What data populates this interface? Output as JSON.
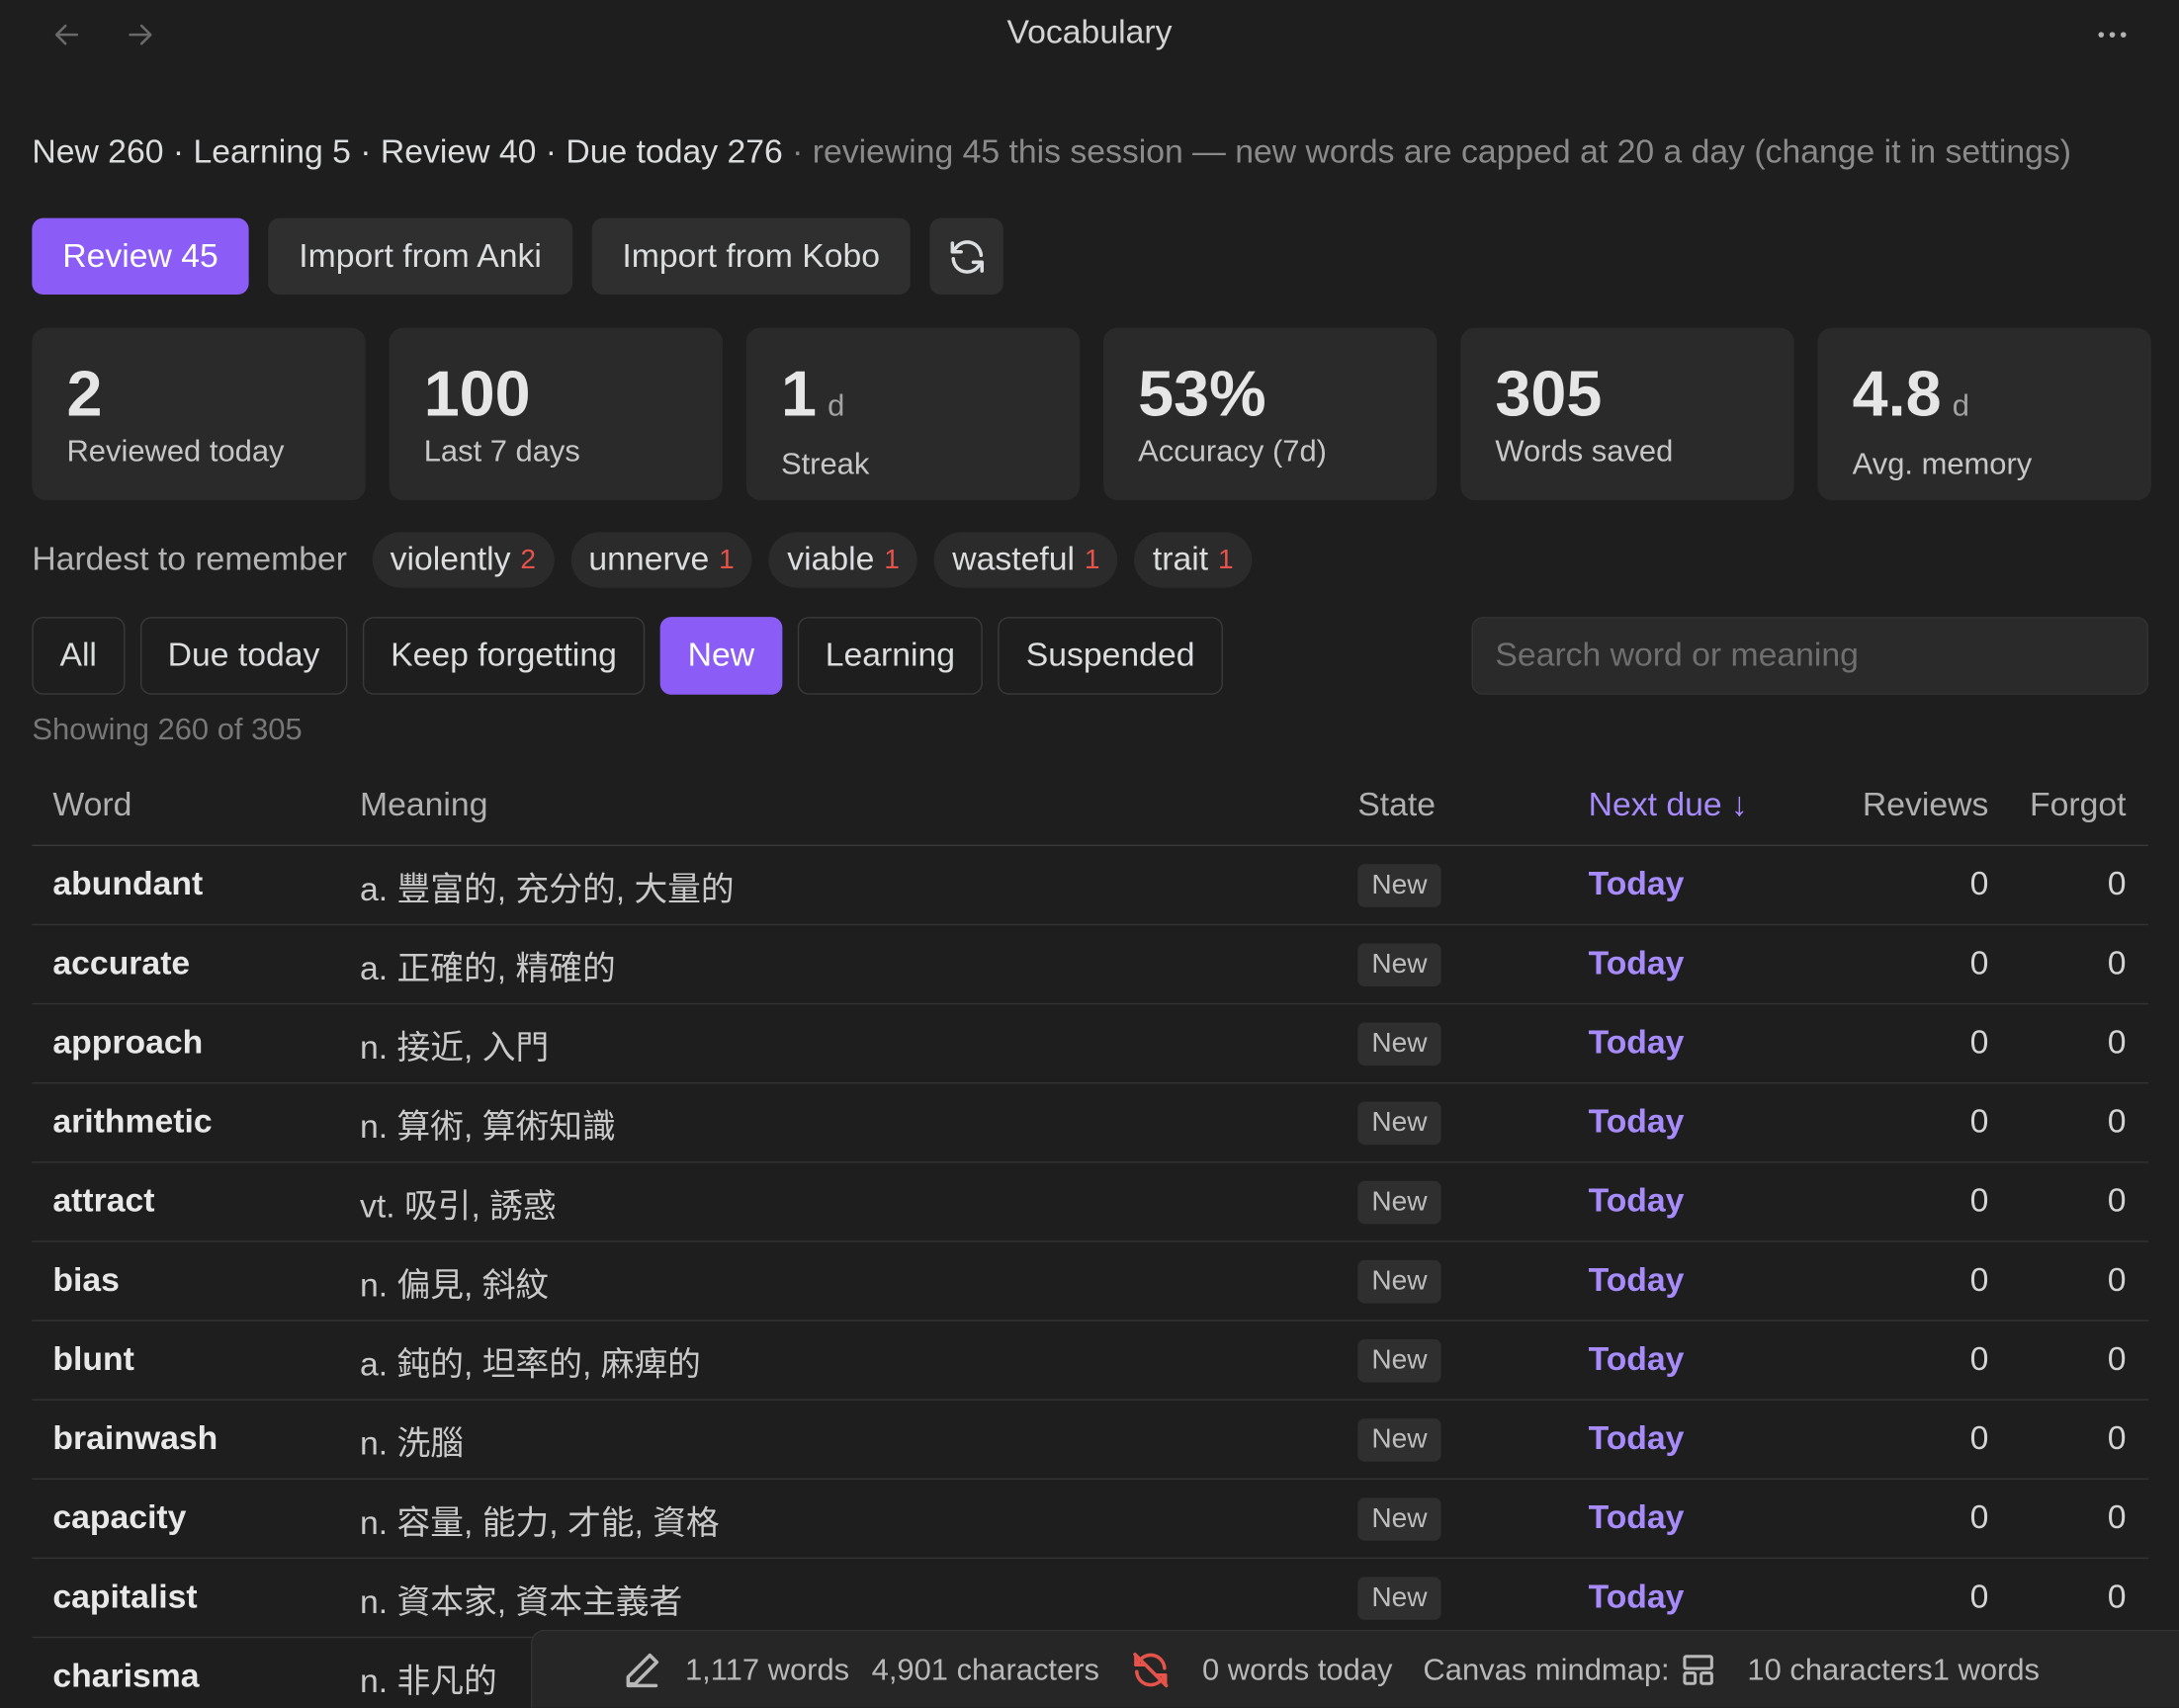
{
  "window": {
    "title": "Vocabulary"
  },
  "summary": {
    "counts": "New 260 · Learning 5 · Review 40 · Due today 276",
    "note": "· reviewing 45 this session — new words are capped at 20 a day (change it in settings)"
  },
  "actions": {
    "review": "Review 45",
    "import_anki": "Import from Anki",
    "import_kobo": "Import from Kobo"
  },
  "stats": [
    {
      "value": "2",
      "unit": "",
      "label": "Reviewed today"
    },
    {
      "value": "100",
      "unit": "",
      "label": "Last 7 days"
    },
    {
      "value": "1",
      "unit": "d",
      "label": "Streak"
    },
    {
      "value": "53%",
      "unit": "",
      "label": "Accuracy (7d)"
    },
    {
      "value": "305",
      "unit": "",
      "label": "Words saved"
    },
    {
      "value": "4.8",
      "unit": "d",
      "label": "Avg. memory"
    }
  ],
  "hardest": {
    "label": "Hardest to remember",
    "words": [
      {
        "word": "violently",
        "count": "2"
      },
      {
        "word": "unnerve",
        "count": "1"
      },
      {
        "word": "viable",
        "count": "1"
      },
      {
        "word": "wasteful",
        "count": "1"
      },
      {
        "word": "trait",
        "count": "1"
      }
    ]
  },
  "filters": {
    "items": [
      "All",
      "Due today",
      "Keep forgetting",
      "New",
      "Learning",
      "Suspended"
    ],
    "active": "New"
  },
  "search": {
    "placeholder": "Search word or meaning",
    "value": ""
  },
  "showing": "Showing 260 of 305",
  "table": {
    "headers": {
      "word": "Word",
      "meaning": "Meaning",
      "state": "State",
      "next_due": "Next due ↓",
      "reviews": "Reviews",
      "forgot": "Forgot"
    },
    "rows": [
      {
        "word": "abundant",
        "meaning": "a. 豐富的, 充分的, 大量的",
        "state": "New",
        "next_due": "Today",
        "reviews": "0",
        "forgot": "0"
      },
      {
        "word": "accurate",
        "meaning": "a. 正確的, 精確的",
        "state": "New",
        "next_due": "Today",
        "reviews": "0",
        "forgot": "0"
      },
      {
        "word": "approach",
        "meaning": "n. 接近, 入門",
        "state": "New",
        "next_due": "Today",
        "reviews": "0",
        "forgot": "0"
      },
      {
        "word": "arithmetic",
        "meaning": "n. 算術, 算術知識",
        "state": "New",
        "next_due": "Today",
        "reviews": "0",
        "forgot": "0"
      },
      {
        "word": "attract",
        "meaning": "vt. 吸引, 誘惑",
        "state": "New",
        "next_due": "Today",
        "reviews": "0",
        "forgot": "0"
      },
      {
        "word": "bias",
        "meaning": "n. 偏見, 斜紋",
        "state": "New",
        "next_due": "Today",
        "reviews": "0",
        "forgot": "0"
      },
      {
        "word": "blunt",
        "meaning": "a. 鈍的, 坦率的, 麻痺的",
        "state": "New",
        "next_due": "Today",
        "reviews": "0",
        "forgot": "0"
      },
      {
        "word": "brainwash",
        "meaning": "n. 洗腦",
        "state": "New",
        "next_due": "Today",
        "reviews": "0",
        "forgot": "0"
      },
      {
        "word": "capacity",
        "meaning": "n. 容量, 能力, 才能, 資格",
        "state": "New",
        "next_due": "Today",
        "reviews": "0",
        "forgot": "0"
      },
      {
        "word": "capitalist",
        "meaning": "n. 資本家, 資本主義者",
        "state": "New",
        "next_due": "Today",
        "reviews": "0",
        "forgot": "0"
      },
      {
        "word": "charisma",
        "meaning": "n. 非凡的",
        "state": "",
        "next_due": "",
        "reviews": "",
        "forgot": ""
      }
    ]
  },
  "statusbar": {
    "words": "1,117 words",
    "characters": "4,901 characters",
    "words_today": "0 words today",
    "canvas": "Canvas mindmap:",
    "selection": "10 characters1 words"
  },
  "colors": {
    "accent": "#8b5cf6",
    "due_text": "#a78bfa",
    "danger": "#e5534b",
    "background": "#1e1e1e"
  }
}
